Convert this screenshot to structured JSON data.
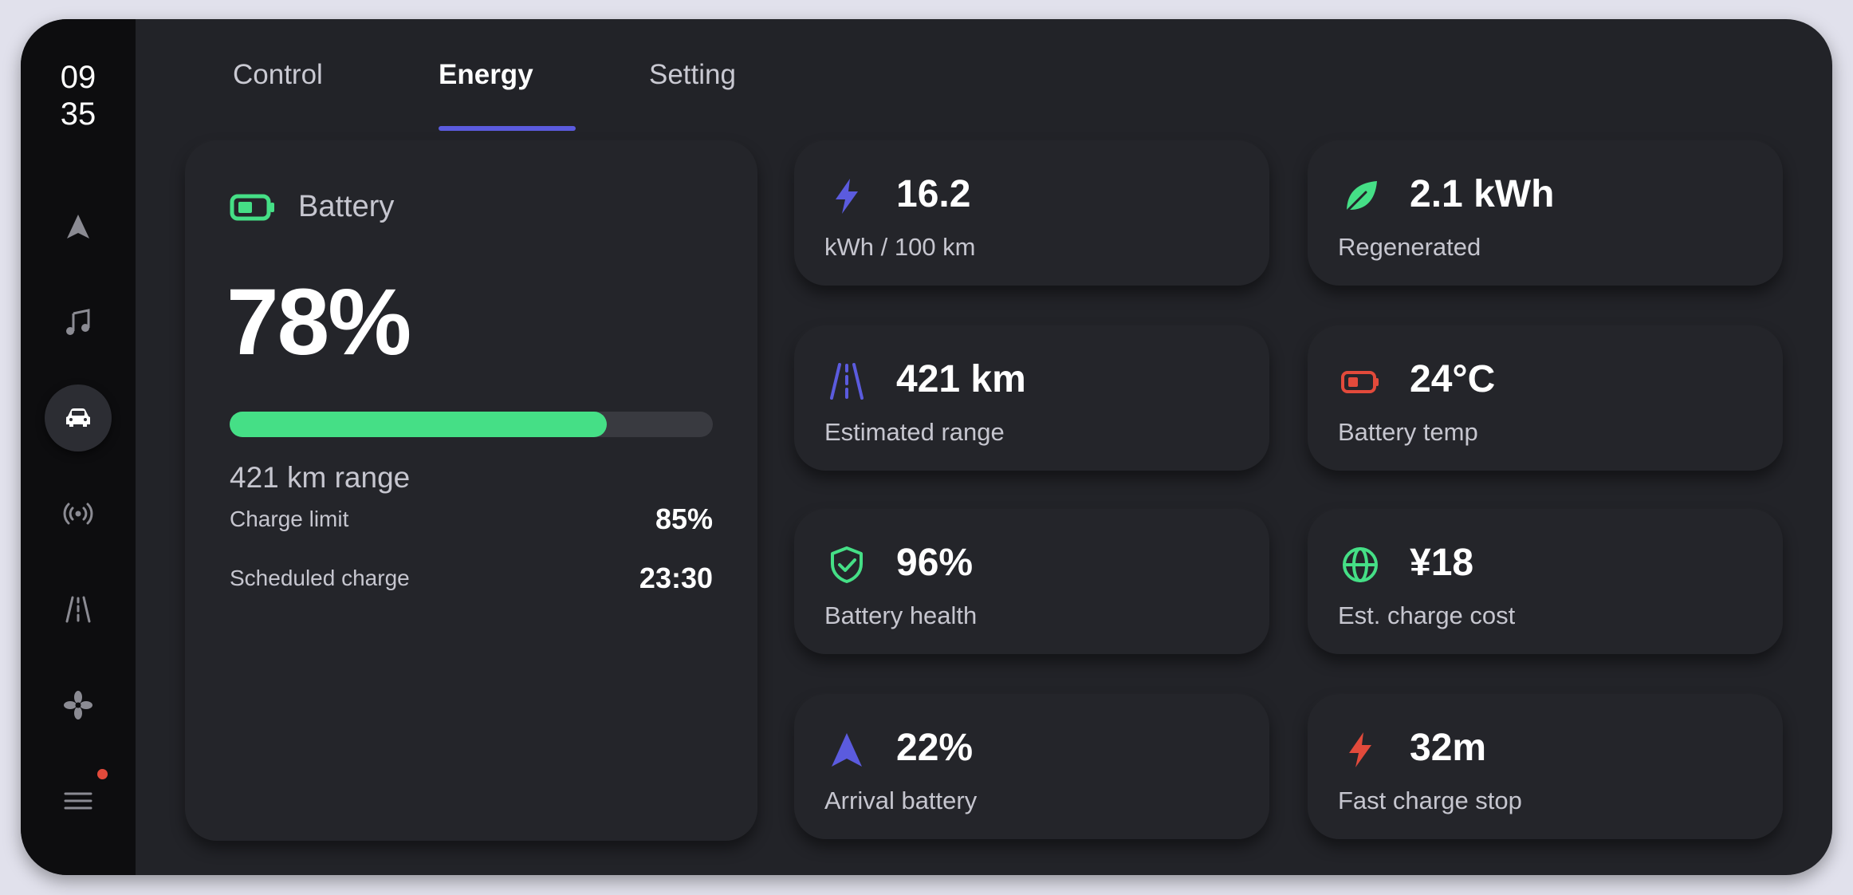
{
  "clock": {
    "hour": "09",
    "minute": "35"
  },
  "sidebar": {
    "items": [
      {
        "name": "navigation",
        "icon": "navigation-arrow-icon",
        "active": false
      },
      {
        "name": "media",
        "icon": "music-note-icon",
        "active": false
      },
      {
        "name": "vehicle",
        "icon": "car-icon",
        "active": true
      },
      {
        "name": "connectivity",
        "icon": "broadcast-signal-icon",
        "active": false
      },
      {
        "name": "road",
        "icon": "road-icon",
        "active": false
      },
      {
        "name": "climate",
        "icon": "fan-icon",
        "active": false
      },
      {
        "name": "menu",
        "icon": "menu-icon",
        "active": false,
        "notification": true
      }
    ]
  },
  "tabs": [
    {
      "label": "Control",
      "active": false
    },
    {
      "label": "Energy",
      "active": true
    },
    {
      "label": "Setting",
      "active": false
    }
  ],
  "battery": {
    "title": "Battery",
    "percent": "78%",
    "level": 0.78,
    "range": "421 km range",
    "charge_limit_label": "Charge limit",
    "charge_limit_value": "85%",
    "scheduled_label": "Scheduled charge",
    "scheduled_value": "23:30"
  },
  "tiles": [
    {
      "value": "16.2",
      "label": "kWh / 100 km",
      "icon": "lightning-bolt-icon",
      "color": "#5b5bde"
    },
    {
      "value": "2.1 kWh",
      "label": "Regenerated",
      "icon": "leaf-icon",
      "color": "#45df86"
    },
    {
      "value": "421 km",
      "label": "Estimated range",
      "icon": "road-icon",
      "color": "#5b5bde"
    },
    {
      "value": "24°C",
      "label": "Battery temp",
      "icon": "battery-icon",
      "color": "#e24a3b"
    },
    {
      "value": "96%",
      "label": "Battery health",
      "icon": "shield-check-icon",
      "color": "#45df86"
    },
    {
      "value": "¥18",
      "label": "Est. charge cost",
      "icon": "globe-icon",
      "color": "#45df86"
    },
    {
      "value": "22%",
      "label": "Arrival battery",
      "icon": "navigation-arrow-icon",
      "color": "#5b5bde"
    },
    {
      "value": "32m",
      "label": "Fast charge stop",
      "icon": "lightning-bolt-icon",
      "color": "#e24a3b"
    }
  ],
  "colors": {
    "accent": "#5b5bde",
    "green": "#45df86",
    "red": "#e24a3b",
    "background": "#222328",
    "card": "#24252a"
  }
}
